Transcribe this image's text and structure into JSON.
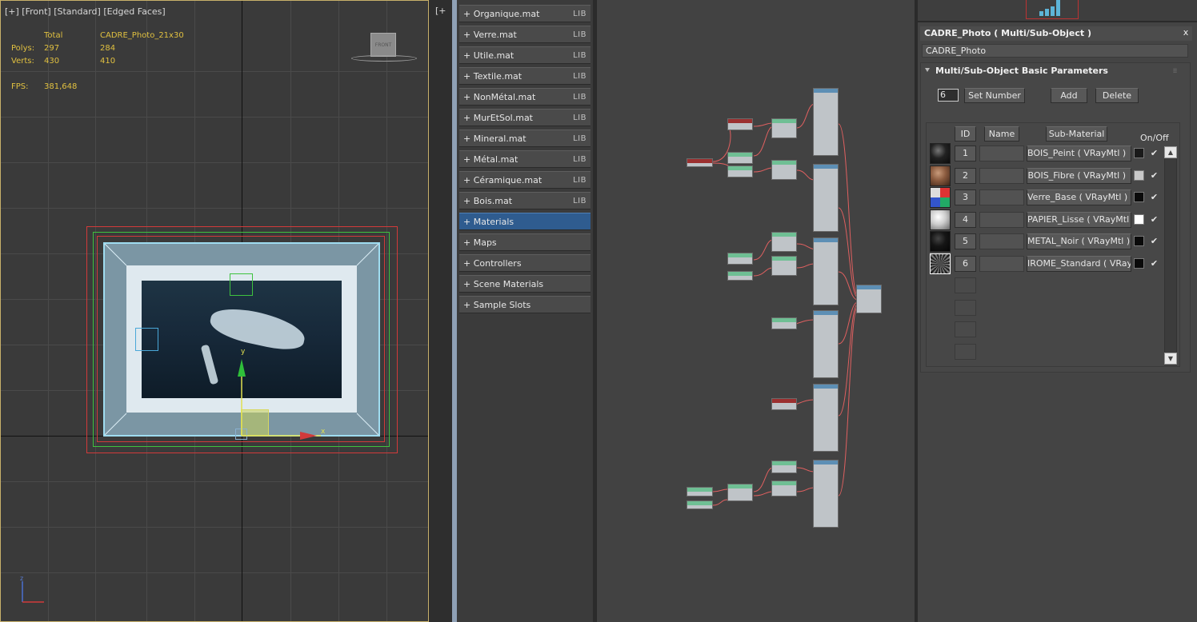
{
  "viewport": {
    "label": "[+] [Front] [Standard] [Edged Faces]",
    "stats": {
      "total_label": "Total",
      "object_name": "CADRE_Photo_21x30",
      "polys_label": "Polys:",
      "polys_total": "297",
      "polys_obj": "284",
      "verts_label": "Verts:",
      "verts_total": "430",
      "verts_obj": "410",
      "fps_label": "FPS:",
      "fps_value": "381,648"
    },
    "viewcube_label": "FRONT",
    "gizmo_y": "y",
    "gizmo_x": "x",
    "axis_z": "z"
  },
  "viewport2_label": "[+",
  "browser": {
    "categories": [
      {
        "label": "+ Organique.mat",
        "tag": "LIB"
      },
      {
        "label": "+ Verre.mat",
        "tag": "LIB"
      },
      {
        "label": "+ Utile.mat",
        "tag": "LIB"
      },
      {
        "label": "+ Textile.mat",
        "tag": "LIB"
      },
      {
        "label": "+ NonMétal.mat",
        "tag": "LIB"
      },
      {
        "label": "+ MurEtSol.mat",
        "tag": "LIB"
      },
      {
        "label": "+ Mineral.mat",
        "tag": "LIB"
      },
      {
        "label": "+ Métal.mat",
        "tag": "LIB"
      },
      {
        "label": "+ Céramique.mat",
        "tag": "LIB"
      },
      {
        "label": "+ Bois.mat",
        "tag": "LIB"
      },
      {
        "label": "+ Materials",
        "tag": ""
      },
      {
        "label": "+ Maps",
        "tag": ""
      },
      {
        "label": "+ Controllers",
        "tag": ""
      },
      {
        "label": "+ Scene Materials",
        "tag": ""
      },
      {
        "label": "+ Sample Slots",
        "tag": ""
      }
    ],
    "active_index": 10
  },
  "panel": {
    "title": "CADRE_Photo  ( Multi/Sub-Object )",
    "close": "x",
    "material_name": "CADRE_Photo",
    "rollout_title": "Multi/Sub-Object Basic Parameters",
    "rollout_grip": "⁞⁞",
    "num_value": "6",
    "set_number": "Set Number",
    "add": "Add",
    "delete": "Delete",
    "headers": {
      "id": "ID",
      "name": "Name",
      "sub_material": "Sub-Material",
      "on_off": "On/Off"
    },
    "rows": [
      {
        "id": "1",
        "material": "BOIS_Peint  ( VRayMtl )",
        "swatch": "#1a1a1a",
        "thumb": "dark-sphere"
      },
      {
        "id": "2",
        "material": "BOIS_Fibre  ( VRayMtl )",
        "swatch": "#c8c8c8",
        "thumb": "wood-sphere"
      },
      {
        "id": "3",
        "material": "Verre_Base  ( VRayMtl )",
        "swatch": "#0a0a0a",
        "thumb": "glass-sphere"
      },
      {
        "id": "4",
        "material": "PAPIER_Lisse  ( VRayMtl )",
        "swatch": "#ffffff",
        "thumb": "white-sphere"
      },
      {
        "id": "5",
        "material": "METAL_Noir  ( VRayMtl )",
        "swatch": "#0a0a0a",
        "thumb": "black-sphere"
      },
      {
        "id": "6",
        "material": "IROME_Standard  ( VRayMt",
        "swatch": "#0a0a0a",
        "thumb": "chrome-sphere"
      }
    ],
    "checkmark": "✔",
    "scroll_up": "▲",
    "scroll_down": "▼"
  },
  "colors": {
    "accent_selected": "#2f5c8f",
    "stats_yellow": "#e0c040",
    "viewport_border": "#c8b06a"
  }
}
